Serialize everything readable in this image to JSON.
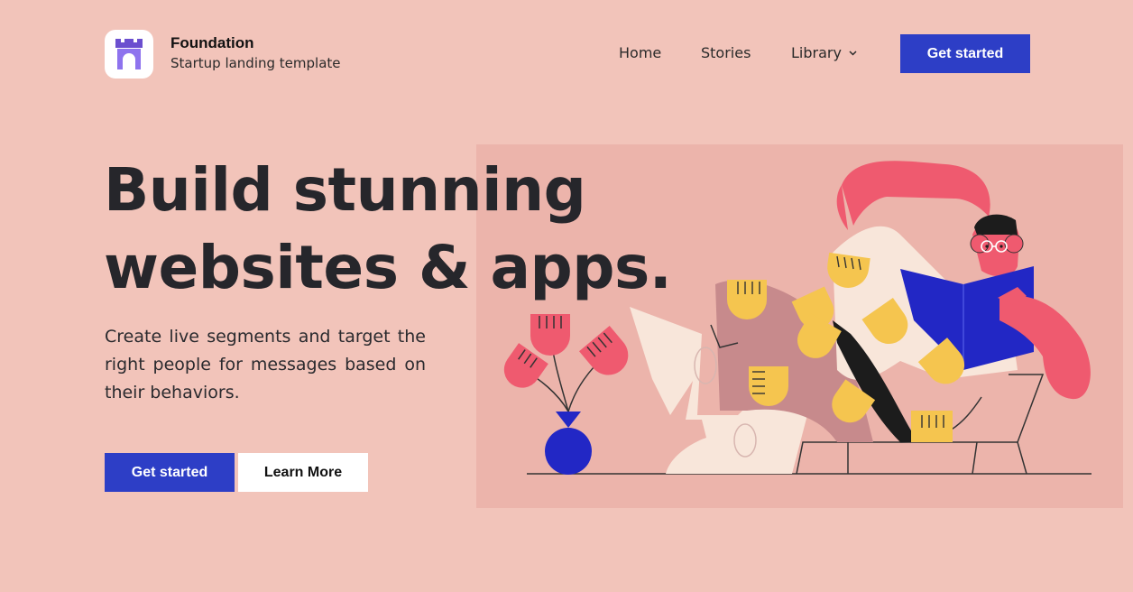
{
  "brand": {
    "name": "Foundation",
    "tagline": "Startup landing template",
    "logo_icon": "castle-gate-icon"
  },
  "nav": {
    "items": [
      {
        "label": "Home"
      },
      {
        "label": "Stories"
      },
      {
        "label": "Library",
        "icon": "chevron-down-icon"
      }
    ],
    "cta_label": "Get started"
  },
  "hero": {
    "title_line1": "Build stunning",
    "title_line2": "websites & apps.",
    "description": "Create live segments and target the right people for messages based on their behaviors.",
    "primary_label": "Get started",
    "secondary_label": "Learn More",
    "illustration": "person-reading-book-illustration"
  },
  "colors": {
    "background": "#f2c4ba",
    "panel": "#ecb4ab",
    "accent": "#2d3ec6",
    "flower_red": "#ef5a6f",
    "leaf_yellow": "#f5c54f",
    "text_dark": "#26262b"
  }
}
